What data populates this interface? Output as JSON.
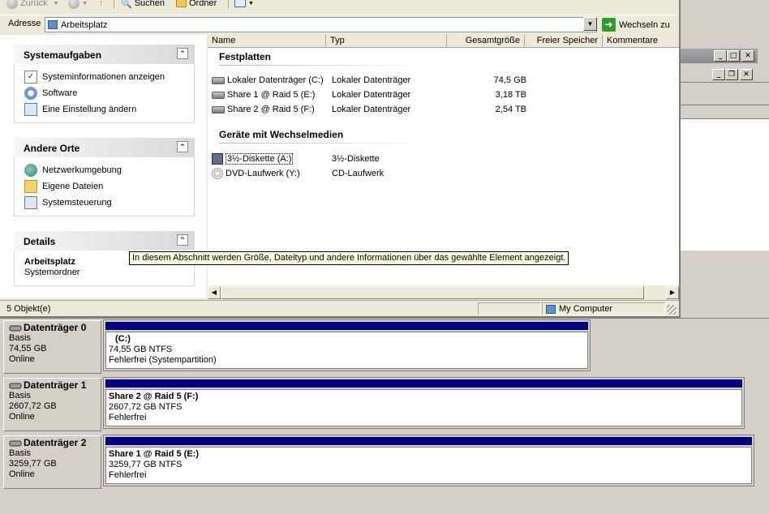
{
  "explorer": {
    "toolbar": {
      "back_label": "Zurück",
      "search_label": "Suchen",
      "folders_label": "Ordner"
    },
    "address": {
      "label": "Adresse",
      "value": "Arbeitsplatz",
      "go_label": "Wechseln zu"
    },
    "taskpane": {
      "system_tasks": {
        "title": "Systemaufgaben",
        "items": [
          {
            "label": "Systeminformationen anzeigen",
            "icon": "system-info-icon"
          },
          {
            "label": "Software",
            "icon": "software-icon"
          },
          {
            "label": "Eine Einstellung ändern",
            "icon": "settings-icon"
          }
        ]
      },
      "other_places": {
        "title": "Andere Orte",
        "items": [
          {
            "label": "Netzwerkumgebung",
            "icon": "network-icon"
          },
          {
            "label": "Eigene Dateien",
            "icon": "folder-icon"
          },
          {
            "label": "Systemsteuerung",
            "icon": "control-panel-icon"
          }
        ]
      },
      "details": {
        "title": "Details",
        "name": "Arbeitsplatz",
        "type": "Systemordner"
      }
    },
    "columns": [
      "Name",
      "Typ",
      "Gesamtgröße",
      "Freier Speicher",
      "Kommentare"
    ],
    "groups": {
      "hard_disks": {
        "title": "Festplatten",
        "items": [
          {
            "name": "Lokaler Datenträger (C:)",
            "type": "Lokaler Datenträger",
            "size": "74,5 GB"
          },
          {
            "name": "Share 1 @ Raid 5 (E:)",
            "type": "Lokaler Datenträger",
            "size": "3,18 TB"
          },
          {
            "name": "Share 2 @ Raid 5 (F:)",
            "type": "Lokaler Datenträger",
            "size": "2,54 TB"
          }
        ]
      },
      "removable": {
        "title": "Geräte mit Wechselmedien",
        "items": [
          {
            "name": "3½-Diskette (A:)",
            "type": "3½-Diskette"
          },
          {
            "name": "DVD-Laufwerk (Y:)",
            "type": "CD-Laufwerk"
          }
        ]
      }
    },
    "tooltip": "In diesem Abschnitt werden Größe, Dateityp und andere Informationen über das gewählte Element angezeigt.",
    "status": {
      "count": "5 Objekt(e)",
      "location": "My Computer"
    }
  },
  "disk_management": {
    "disks": [
      {
        "name": "Datenträger 0",
        "kind": "Basis",
        "size": "74,55 GB",
        "state": "Online",
        "partition": {
          "name": "(C:)",
          "fs": "74,55 GB NTFS",
          "status": "Fehlerfrei (Systempartition)"
        }
      },
      {
        "name": "Datenträger 1",
        "kind": "Basis",
        "size": "2607,72 GB",
        "state": "Online",
        "partition": {
          "name": "Share 2 @ Raid 5  (F:)",
          "fs": "2607,72 GB NTFS",
          "status": "Fehlerfrei"
        }
      },
      {
        "name": "Datenträger 2",
        "kind": "Basis",
        "size": "3259,77 GB",
        "state": "Online",
        "partition": {
          "name": "Share 1 @ Raid 5  (E:)",
          "fs": "3259,77 GB NTFS",
          "status": "Fehlerfrei"
        }
      }
    ]
  },
  "colors": {
    "partition_bar": "#000080",
    "window_face": "#ece9d8",
    "classic_face": "#d4d0c8"
  }
}
